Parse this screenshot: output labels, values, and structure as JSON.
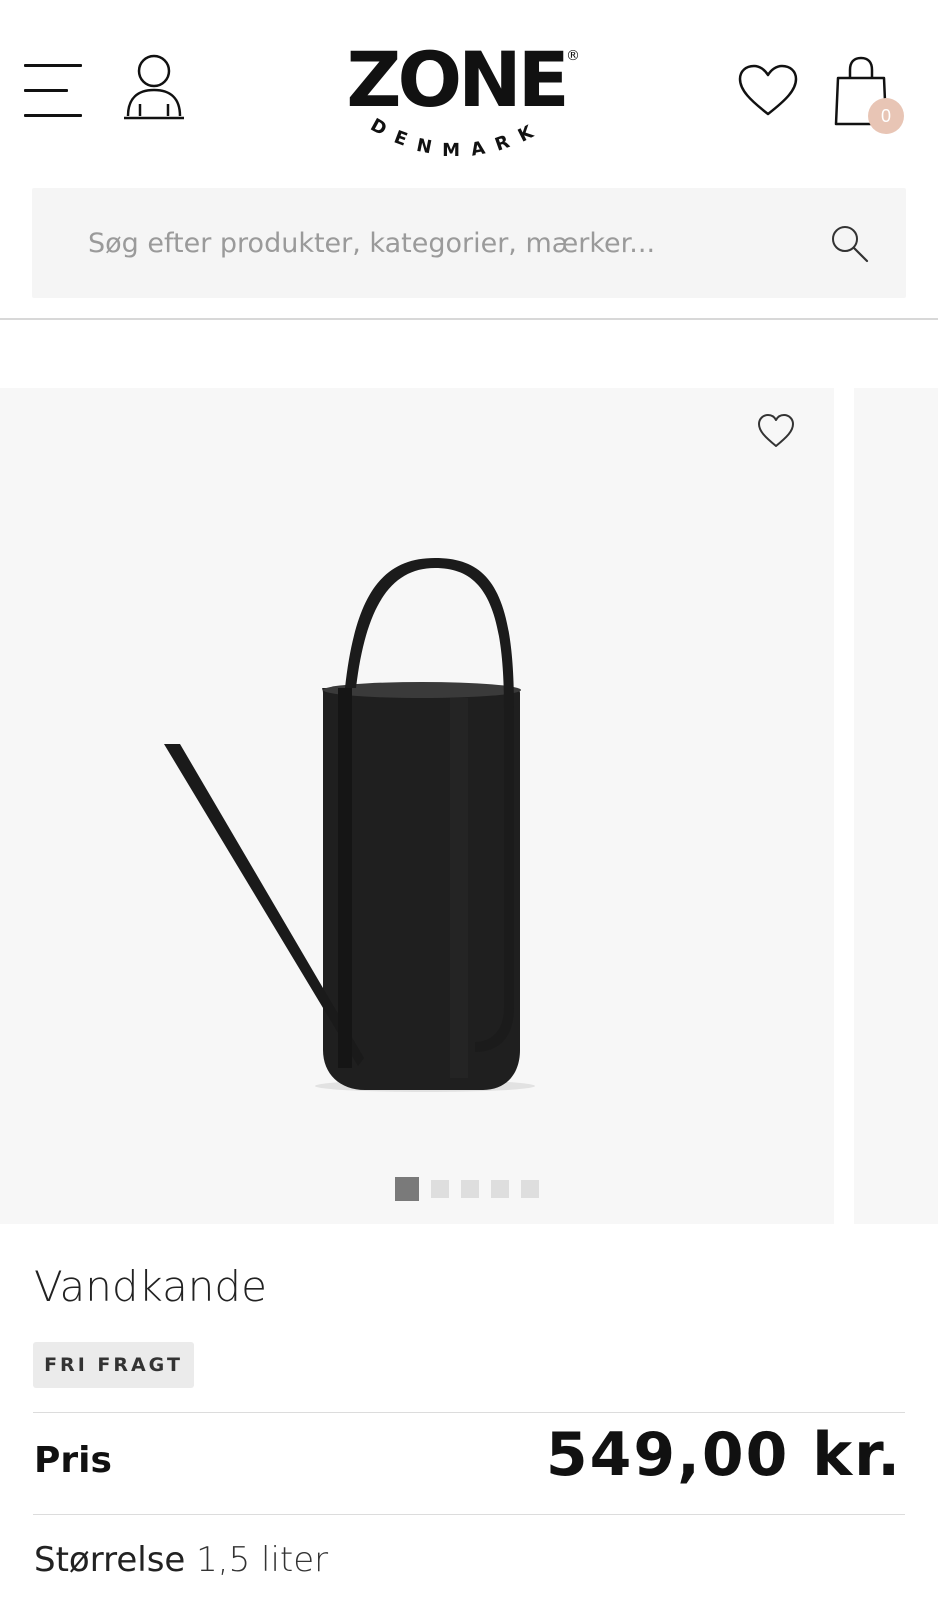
{
  "header": {
    "logo_text": "ZONE",
    "logo_sub": "DENMARK",
    "cart_count": "0"
  },
  "search": {
    "placeholder": "Søg efter produkter, kategorier, mærker..."
  },
  "gallery": {
    "image_count": 5,
    "active_index": 0
  },
  "product": {
    "title": "Vandkande",
    "badge": "FRI FRAGT",
    "price_label": "Pris",
    "price": "549,00 kr.",
    "size_label": "Størrelse",
    "size_value": "1,5 liter"
  },
  "colors": {
    "cart_badge": "#e8c5b5",
    "search_bg": "#f5f5f5",
    "gallery_bg": "#f7f7f7",
    "dot_active": "#7a7a7a",
    "dot_inactive": "#dedede"
  },
  "icons": [
    "menu-icon",
    "account-icon",
    "heart-icon",
    "shopping-bag-icon",
    "search-icon"
  ]
}
